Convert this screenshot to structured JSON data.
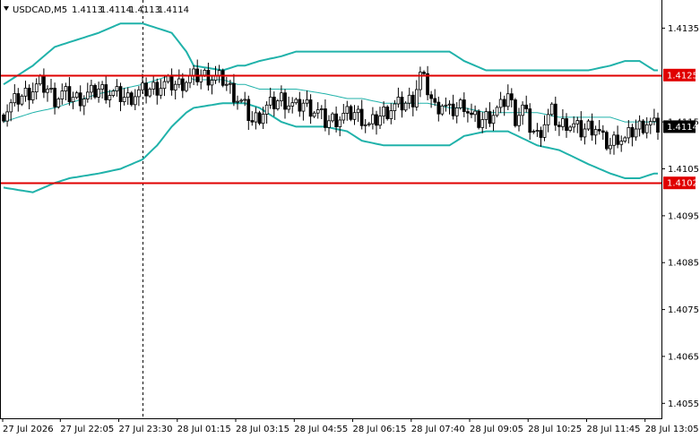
{
  "chart_data": {
    "type": "candlestick",
    "title": "USDCAD,M5",
    "ohlc_header": [
      "1.4113",
      "1.4114",
      "1.4113",
      "1.4114"
    ],
    "ylim": [
      1.4052,
      1.4141
    ],
    "y_ticks": [
      {
        "value": 1.4135,
        "label": "1.4135"
      },
      {
        "value": 1.4115,
        "label": "1.4115"
      },
      {
        "value": 1.4105,
        "label": "1.4105"
      },
      {
        "value": 1.4095,
        "label": "1.4095"
      },
      {
        "value": 1.4085,
        "label": "1.4085"
      },
      {
        "value": 1.4075,
        "label": "1.4075"
      },
      {
        "value": 1.4065,
        "label": "1.4065"
      },
      {
        "value": 1.4055,
        "label": "1.4055"
      }
    ],
    "x_labels": [
      "27 Jul 2026",
      "27 Jul 22:05",
      "27 Jul 23:30",
      "28 Jul 01:15",
      "28 Jul 03:15",
      "28 Jul 04:55",
      "28 Jul 06:15",
      "28 Jul 07:40",
      "28 Jul 09:05",
      "28 Jul 10:25",
      "28 Jul 11:45",
      "28 Jul 13:05"
    ],
    "x_label_bar_index": [
      0,
      16,
      32,
      48,
      64,
      80,
      96,
      112,
      128,
      144,
      160,
      176
    ],
    "bar_count": 180,
    "day_separator_bar_index": 38,
    "horizontal_levels": [
      {
        "value": 1.4125,
        "label": "1.4125",
        "color": "#e00000"
      },
      {
        "value": 1.4102,
        "label": "1.4102",
        "color": "#e00000"
      }
    ],
    "current_price": {
      "value": 1.4114,
      "label": "1.4114"
    },
    "bollinger": {
      "anchor_index": [
        0,
        8,
        14,
        18,
        26,
        32,
        38,
        42,
        46,
        50,
        52,
        60,
        64,
        66,
        70,
        76,
        80,
        88,
        94,
        98,
        104,
        110,
        116,
        122,
        126,
        132,
        138,
        146,
        152,
        160,
        166,
        170,
        174,
        178
      ],
      "upper": [
        1.4123,
        1.4127,
        1.4131,
        1.4132,
        1.4134,
        1.4136,
        1.4136,
        1.4135,
        1.4134,
        1.413,
        1.4127,
        1.4126,
        1.4127,
        1.4127,
        1.4128,
        1.4129,
        1.413,
        1.413,
        1.413,
        1.413,
        1.413,
        1.413,
        1.413,
        1.413,
        1.4128,
        1.4126,
        1.4126,
        1.4126,
        1.4126,
        1.4126,
        1.4127,
        1.4128,
        1.4128,
        1.4126
      ],
      "middle": [
        1.4115,
        1.4117,
        1.4118,
        1.4119,
        1.4121,
        1.4122,
        1.4123,
        1.4124,
        1.4125,
        1.4125,
        1.4124,
        1.4124,
        1.4123,
        1.4123,
        1.4122,
        1.4122,
        1.4122,
        1.4121,
        1.412,
        1.412,
        1.4119,
        1.4119,
        1.4119,
        1.4118,
        1.4118,
        1.4117,
        1.4117,
        1.4117,
        1.4116,
        1.4116,
        1.4116,
        1.4115,
        1.4115,
        1.4115
      ],
      "lower": [
        1.4101,
        1.41,
        1.4102,
        1.4103,
        1.4104,
        1.4105,
        1.4107,
        1.411,
        1.4114,
        1.4117,
        1.4118,
        1.4119,
        1.4119,
        1.4119,
        1.4118,
        1.4115,
        1.4114,
        1.4114,
        1.4113,
        1.4111,
        1.411,
        1.411,
        1.411,
        1.411,
        1.4112,
        1.4113,
        1.4113,
        1.411,
        1.4109,
        1.4106,
        1.4104,
        1.4103,
        1.4103,
        1.4104
      ]
    },
    "close_path": {
      "anchor_index": [
        0,
        4,
        6,
        10,
        12,
        14,
        16,
        20,
        24,
        26,
        30,
        34,
        36,
        40,
        44,
        48,
        50,
        54,
        60,
        62,
        66,
        68,
        72,
        76,
        80,
        82,
        86,
        88,
        92,
        96,
        98,
        100,
        104,
        106,
        110,
        112,
        114,
        116,
        118,
        120,
        122,
        126,
        128,
        130,
        134,
        136,
        138,
        140,
        142,
        144,
        146,
        148,
        150,
        152,
        154,
        156,
        158,
        160,
        162,
        164,
        166,
        168,
        170,
        172,
        176,
        178
      ],
      "close": [
        1.4117,
        1.412,
        1.4121,
        1.4123,
        1.4122,
        1.412,
        1.4121,
        1.412,
        1.4121,
        1.4122,
        1.4121,
        1.412,
        1.4121,
        1.4122,
        1.4123,
        1.4123,
        1.4124,
        1.4125,
        1.4124,
        1.4122,
        1.4118,
        1.4115,
        1.4118,
        1.412,
        1.4118,
        1.4119,
        1.4117,
        1.4115,
        1.4116,
        1.4117,
        1.4116,
        1.4114,
        1.4117,
        1.4118,
        1.4119,
        1.412,
        1.4125,
        1.4122,
        1.4118,
        1.4119,
        1.4117,
        1.4119,
        1.4116,
        1.4115,
        1.4117,
        1.4118,
        1.4121,
        1.4116,
        1.4118,
        1.4114,
        1.4112,
        1.4115,
        1.4117,
        1.4114,
        1.4115,
        1.4114,
        1.4113,
        1.4114,
        1.4114,
        1.4111,
        1.411,
        1.4112,
        1.4111,
        1.4113,
        1.4115,
        1.4114
      ]
    },
    "grid": false,
    "colors": {
      "background": "#ffffff",
      "bull": "#ffffff",
      "bear": "#000000",
      "wick": "#000000",
      "bands": "#20b2aa",
      "middle_band": "#20b2aa",
      "levels": "#e00000",
      "axis": "#000000",
      "separator": "#000000"
    }
  }
}
